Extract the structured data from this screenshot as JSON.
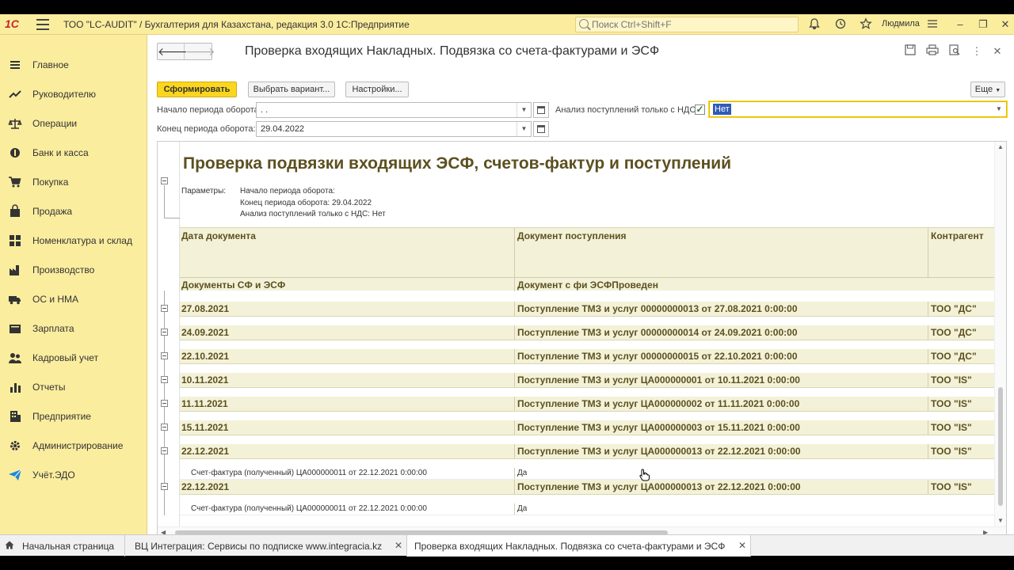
{
  "window": {
    "title": "ТОО \"LC-AUDIT\" / Бухгалтерия для Казахстана, редакция 3.0 1С:Предприятие",
    "logo": "1С",
    "search_placeholder": "Поиск Ctrl+Shift+F",
    "user": "Людмила"
  },
  "sidebar": {
    "items": [
      {
        "label": "Главное",
        "icon": "menu-lines-icon"
      },
      {
        "label": "Руководителю",
        "icon": "trend-line-icon"
      },
      {
        "label": "Операции",
        "icon": "scales-icon"
      },
      {
        "label": "Банк и касса",
        "icon": "coin-icon"
      },
      {
        "label": "Покупка",
        "icon": "cart-icon"
      },
      {
        "label": "Продажа",
        "icon": "bag-icon"
      },
      {
        "label": "Номенклатура и склад",
        "icon": "grid-icon"
      },
      {
        "label": "Производство",
        "icon": "factory-icon"
      },
      {
        "label": "ОС и НМА",
        "icon": "truck-icon"
      },
      {
        "label": "Зарплата",
        "icon": "wallet-icon"
      },
      {
        "label": "Кадровый учет",
        "icon": "people-icon"
      },
      {
        "label": "Отчеты",
        "icon": "bar-chart-icon"
      },
      {
        "label": "Предприятие",
        "icon": "building-icon"
      },
      {
        "label": "Администрирование",
        "icon": "gear-icon"
      },
      {
        "label": "Учёт.ЭДО",
        "icon": "paper-plane-icon"
      }
    ]
  },
  "form": {
    "title": "Проверка входящих Накладных. Подвязка со счета-фактурами и ЭСФ",
    "buttons": {
      "generate": "Сформировать",
      "choose_variant": "Выбрать вариант...",
      "settings": "Настройки...",
      "more": "Еще"
    },
    "fields": {
      "period_start_label": "Начало периода оборота:",
      "period_start_value": ". .",
      "period_end_label": "Конец периода оборота:",
      "period_end_value": "29.04.2022",
      "vat_label": "Анализ поступлений только с НДС:",
      "vat_checked": true,
      "vat_value": "Нет"
    }
  },
  "report": {
    "title": "Проверка подвязки входящих ЭСФ, счетов-фактур и поступлений",
    "params_label": "Параметры:",
    "params": [
      "Начало периода оборота:",
      "Конец периода оборота: 29.04.2022",
      "Анализ поступлений только с НДС: Нет"
    ],
    "headers": {
      "col1_top": "Дата документа",
      "col2_top": "Документ поступления",
      "col3_top": "Контрагент",
      "col1_bottom": "Документы СФ и ЭСФ",
      "col2_bottom": "Документ с фи ЭСФПроведен"
    },
    "rows": [
      {
        "date": "27.08.2021",
        "doc": "Поступление ТМЗ и услуг 00000000013 от 27.08.2021 0:00:00",
        "counterparty": "ТОО \"ДС\""
      },
      {
        "date": "24.09.2021",
        "doc": "Поступление ТМЗ и услуг 00000000014 от 24.09.2021 0:00:00",
        "counterparty": "ТОО \"ДС\""
      },
      {
        "date": "22.10.2021",
        "doc": "Поступление ТМЗ и услуг 00000000015 от 22.10.2021 0:00:00",
        "counterparty": "ТОО \"ДС\""
      },
      {
        "date": "10.11.2021",
        "doc": "Поступление ТМЗ и услуг ЦА000000001 от 10.11.2021 0:00:00",
        "counterparty": "ТОО \"IS\""
      },
      {
        "date": "11.11.2021",
        "doc": "Поступление ТМЗ и услуг ЦА000000002 от 11.11.2021 0:00:00",
        "counterparty": "ТОО \"IS\""
      },
      {
        "date": "15.11.2021",
        "doc": "Поступление ТМЗ и услуг ЦА000000003 от 15.11.2021 0:00:00",
        "counterparty": "ТОО \"IS\""
      },
      {
        "date": "22.12.2021",
        "doc": "Поступление ТМЗ и услуг ЦА000000013 от 22.12.2021 0:00:00",
        "counterparty": "ТОО \"IS\""
      },
      {
        "detail": "Счет-фактура (полученный) ЦА000000011 от 22.12.2021 0:00:00",
        "posted": "Да"
      },
      {
        "date": "22.12.2021",
        "doc": "Поступление ТМЗ и услуг ЦА000000013 от 22.12.2021 0:00:00",
        "counterparty": "ТОО \"IS\""
      },
      {
        "detail": "Счет-фактура (полученный) ЦА000000011 от 22.12.2021 0:00:00",
        "posted": "Да"
      }
    ]
  },
  "tabs": [
    {
      "label": "Начальная страница"
    },
    {
      "label": "ВЦ Интеграция: Сервисы по подписке www.integracia.kz"
    },
    {
      "label": "Проверка входящих Накладных. Подвязка со счета-фактурами и ЭСФ"
    }
  ],
  "colors": {
    "sidebar_bg": "#fbed9e",
    "primary_button": "#fbd61e",
    "report_header_bg": "#f3f2d8",
    "report_text": "#5c5020"
  }
}
